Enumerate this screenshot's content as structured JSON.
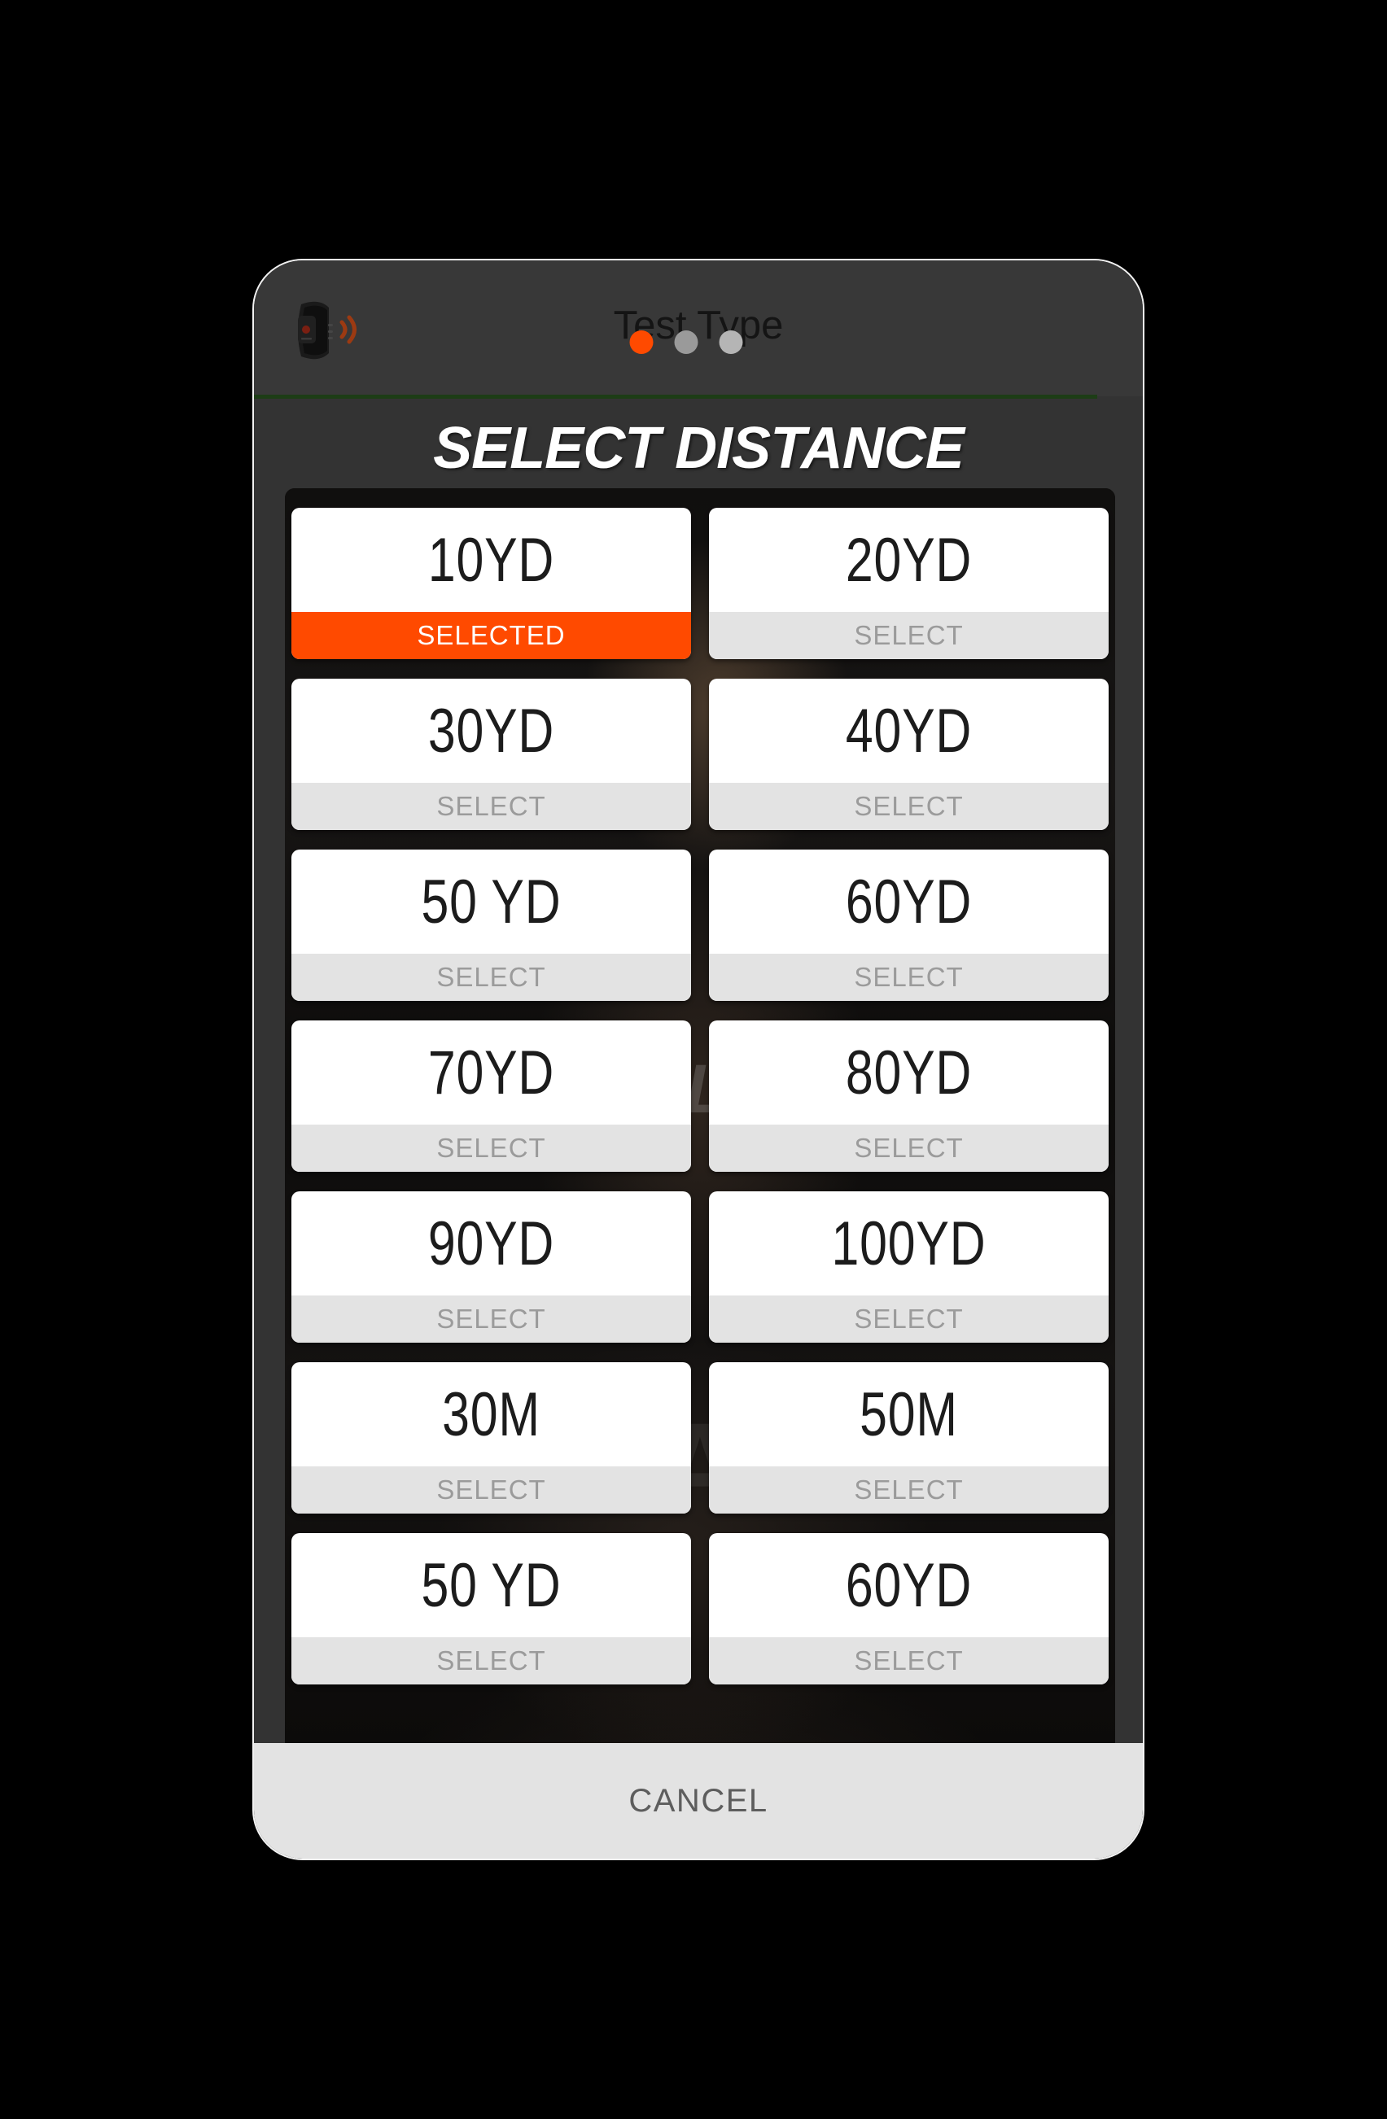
{
  "header": {
    "title": "Test Type",
    "device_icon": "fitness-band-icon",
    "signal_icon": "wireless-signal-icon",
    "page_dots": [
      {
        "state": "active",
        "color": "#ff4a00"
      },
      {
        "state": "inactive",
        "color": "#9a9a9a"
      },
      {
        "state": "inactive",
        "color": "#b5b5b5"
      }
    ],
    "rule_color": "#1d3d16"
  },
  "page": {
    "title": "SELECT DISTANCE"
  },
  "background": {
    "watermark": "AGILITY",
    "watermark2": "A"
  },
  "colors": {
    "selected": "#ff4a00",
    "dialog_bg": "#333333",
    "header_bg": "#383838",
    "action_bg": "#e3e3e3",
    "action_text": "#9b9b9b",
    "cancel_text": "#5d5d5d"
  },
  "labels": {
    "select": "SELECT",
    "selected": "SELECTED",
    "cancel": "CANCEL"
  },
  "options": [
    {
      "value": "10YD",
      "action": "SELECTED",
      "selected": true
    },
    {
      "value": "20YD",
      "action": "SELECT",
      "selected": false
    },
    {
      "value": "30YD",
      "action": "SELECT",
      "selected": false
    },
    {
      "value": "40YD",
      "action": "SELECT",
      "selected": false
    },
    {
      "value": "50 YD",
      "action": "SELECT",
      "selected": false
    },
    {
      "value": "60YD",
      "action": "SELECT",
      "selected": false
    },
    {
      "value": "70YD",
      "action": "SELECT",
      "selected": false
    },
    {
      "value": "80YD",
      "action": "SELECT",
      "selected": false
    },
    {
      "value": "90YD",
      "action": "SELECT",
      "selected": false
    },
    {
      "value": "100YD",
      "action": "SELECT",
      "selected": false
    },
    {
      "value": "30M",
      "action": "SELECT",
      "selected": false
    },
    {
      "value": "50M",
      "action": "SELECT",
      "selected": false
    },
    {
      "value": "50 YD",
      "action": "SELECT",
      "selected": false
    },
    {
      "value": "60YD",
      "action": "SELECT",
      "selected": false
    }
  ]
}
